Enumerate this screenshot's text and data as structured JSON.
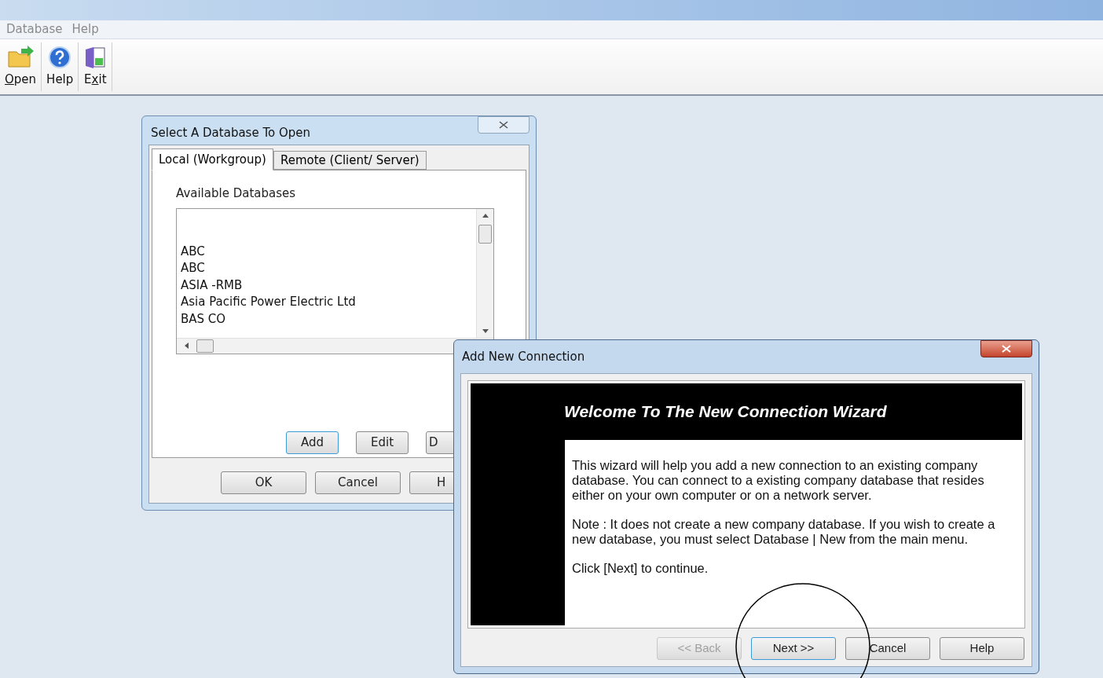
{
  "menu": [
    "Database",
    "Help"
  ],
  "toolbar": [
    {
      "kind": "open",
      "label": "Open"
    },
    {
      "kind": "help",
      "label": "Help"
    },
    {
      "kind": "exit",
      "label": "Exit"
    }
  ],
  "select_dialog": {
    "title": "Select A  Database To Open",
    "tabs": [
      {
        "label": "Local (Workgroup)",
        "selected": true
      },
      {
        "label": "Remote (Client/ Server)",
        "selected": false
      }
    ],
    "list_label": "Available Databases",
    "databases": [
      "ABC",
      "ABC",
      "ASIA -RMB",
      "Asia Pacific Power Electric Ltd",
      "BAS CO"
    ],
    "list_buttons": [
      {
        "label": "Add",
        "focused": true
      },
      {
        "label": "Edit",
        "focused": false
      },
      {
        "label": "D",
        "focused": false
      }
    ],
    "buttons": [
      "OK",
      "Cancel",
      "H"
    ]
  },
  "wizard": {
    "title": "Add New Connection",
    "heading": "Welcome To The New Connection Wizard",
    "paragraphs": [
      "This wizard will help you add a new connection to an existing company database. You can connect to a existing company database that resides  either on your own computer or on a network server.",
      "Note : It does not create a new company database. If you wish to create a new database, you must select Database | New from the main menu.",
      "Click [Next] to continue."
    ],
    "buttons": [
      {
        "label": "<< Back",
        "disabled": true,
        "focused": false
      },
      {
        "label": "Next >>",
        "disabled": false,
        "focused": true
      },
      {
        "label": "Cancel",
        "disabled": false,
        "focused": false
      },
      {
        "label": "Help",
        "disabled": false,
        "focused": false
      }
    ]
  }
}
